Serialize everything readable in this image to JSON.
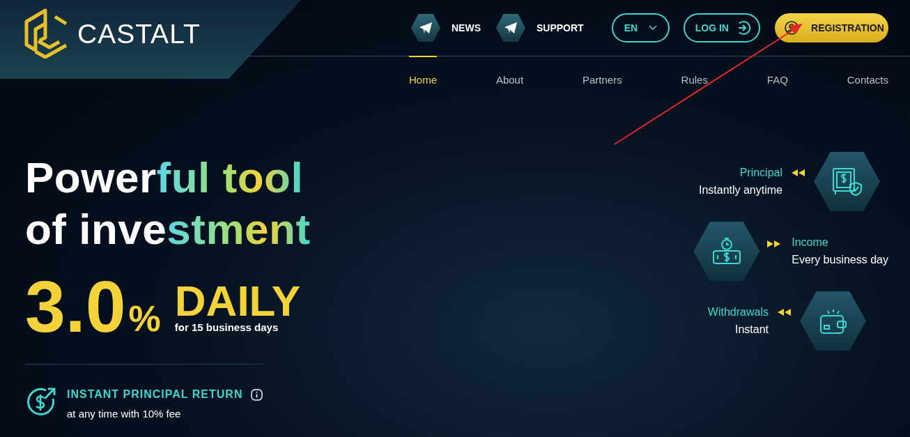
{
  "logo": {
    "text": "CASTALT"
  },
  "top_links": [
    {
      "label": "NEWS"
    },
    {
      "label": "SUPPORT"
    }
  ],
  "language": {
    "value": "EN",
    "expanded": false
  },
  "login_button": {
    "label": "LOG IN"
  },
  "registration_button": {
    "label": "REGISTRATION"
  },
  "nav": [
    {
      "label": "Home",
      "selected": true
    },
    {
      "label": "About",
      "selected": false
    },
    {
      "label": "Partners",
      "selected": false
    },
    {
      "label": "Rules",
      "selected": false
    },
    {
      "label": "FAQ",
      "selected": false
    },
    {
      "label": "Contacts",
      "selected": false
    }
  ],
  "headline": [
    [
      {
        "text": "Power",
        "gradient": false
      },
      {
        "text": "ful tool",
        "gradient": true
      }
    ],
    [
      {
        "text": "of inve",
        "gradient": false
      },
      {
        "text": "stment",
        "gradient": true
      }
    ]
  ],
  "rate": {
    "value": "3.0",
    "unit": "%",
    "label": "DAILY",
    "term": "for 15 business days"
  },
  "feature": {
    "title": "INSTANT PRINCIPAL RETURN",
    "subtitle": "at any time with 10% fee"
  },
  "benefits": [
    {
      "kind": "icon_right",
      "title": "Principal",
      "subtitle": "Instantly anytime"
    },
    {
      "kind": "icon_left",
      "title": "Income",
      "subtitle": "Every business day"
    },
    {
      "kind": "icon_right",
      "title": "Withdrawals",
      "subtitle": "Instant"
    }
  ]
}
